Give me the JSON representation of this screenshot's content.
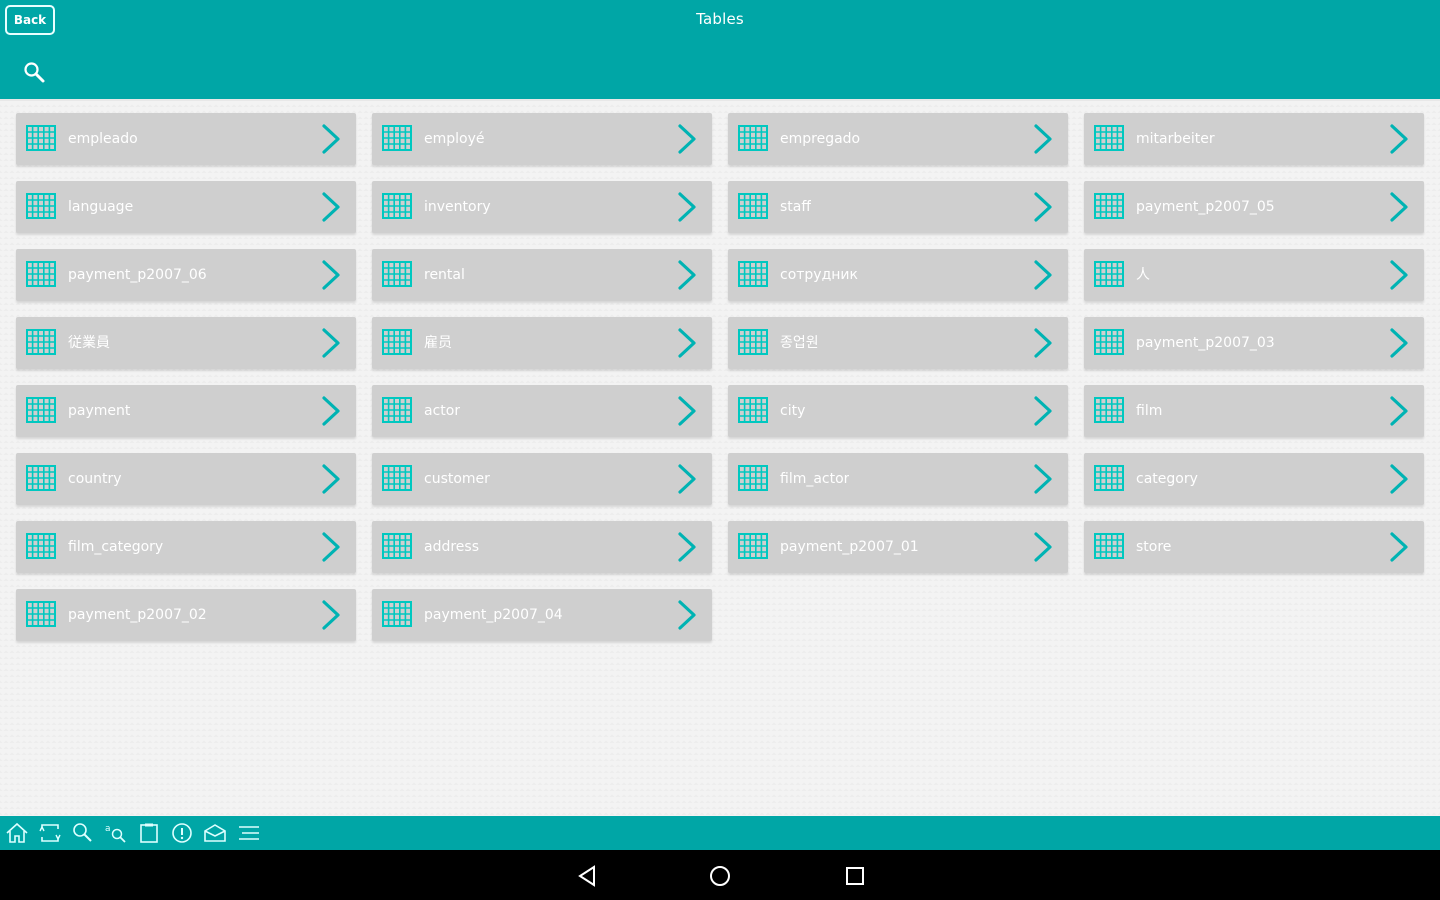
{
  "header": {
    "back_label": "Back",
    "title": "Tables"
  },
  "tables": [
    "empleado",
    "employé",
    "empregado",
    "mitarbeiter",
    "language",
    "inventory",
    "staff",
    "payment_p2007_05",
    "payment_p2007_06",
    "rental",
    "сотрудник",
    "人",
    "従業員",
    "雇员",
    "종업원",
    "payment_p2007_03",
    "payment",
    "actor",
    "city",
    "film",
    "country",
    "customer",
    "film_actor",
    "category",
    "film_category",
    "address",
    "payment_p2007_01",
    "store",
    "payment_p2007_02",
    "payment_p2007_04"
  ],
  "toolbar": {
    "icons": [
      "home-icon",
      "refresh-icon",
      "search-icon",
      "find-replace-icon",
      "clipboard-icon",
      "info-icon",
      "mail-icon",
      "menu-lines-icon"
    ]
  },
  "navbar": {
    "icons": [
      "back-triangle-icon",
      "home-circle-icon",
      "recents-square-icon"
    ]
  },
  "colors": {
    "accent": "#00a6a6",
    "tile": "#cfcfcf",
    "tile_icon": "#00c8c0",
    "chevron": "#00b3b3",
    "background": "#f3f3f3"
  }
}
